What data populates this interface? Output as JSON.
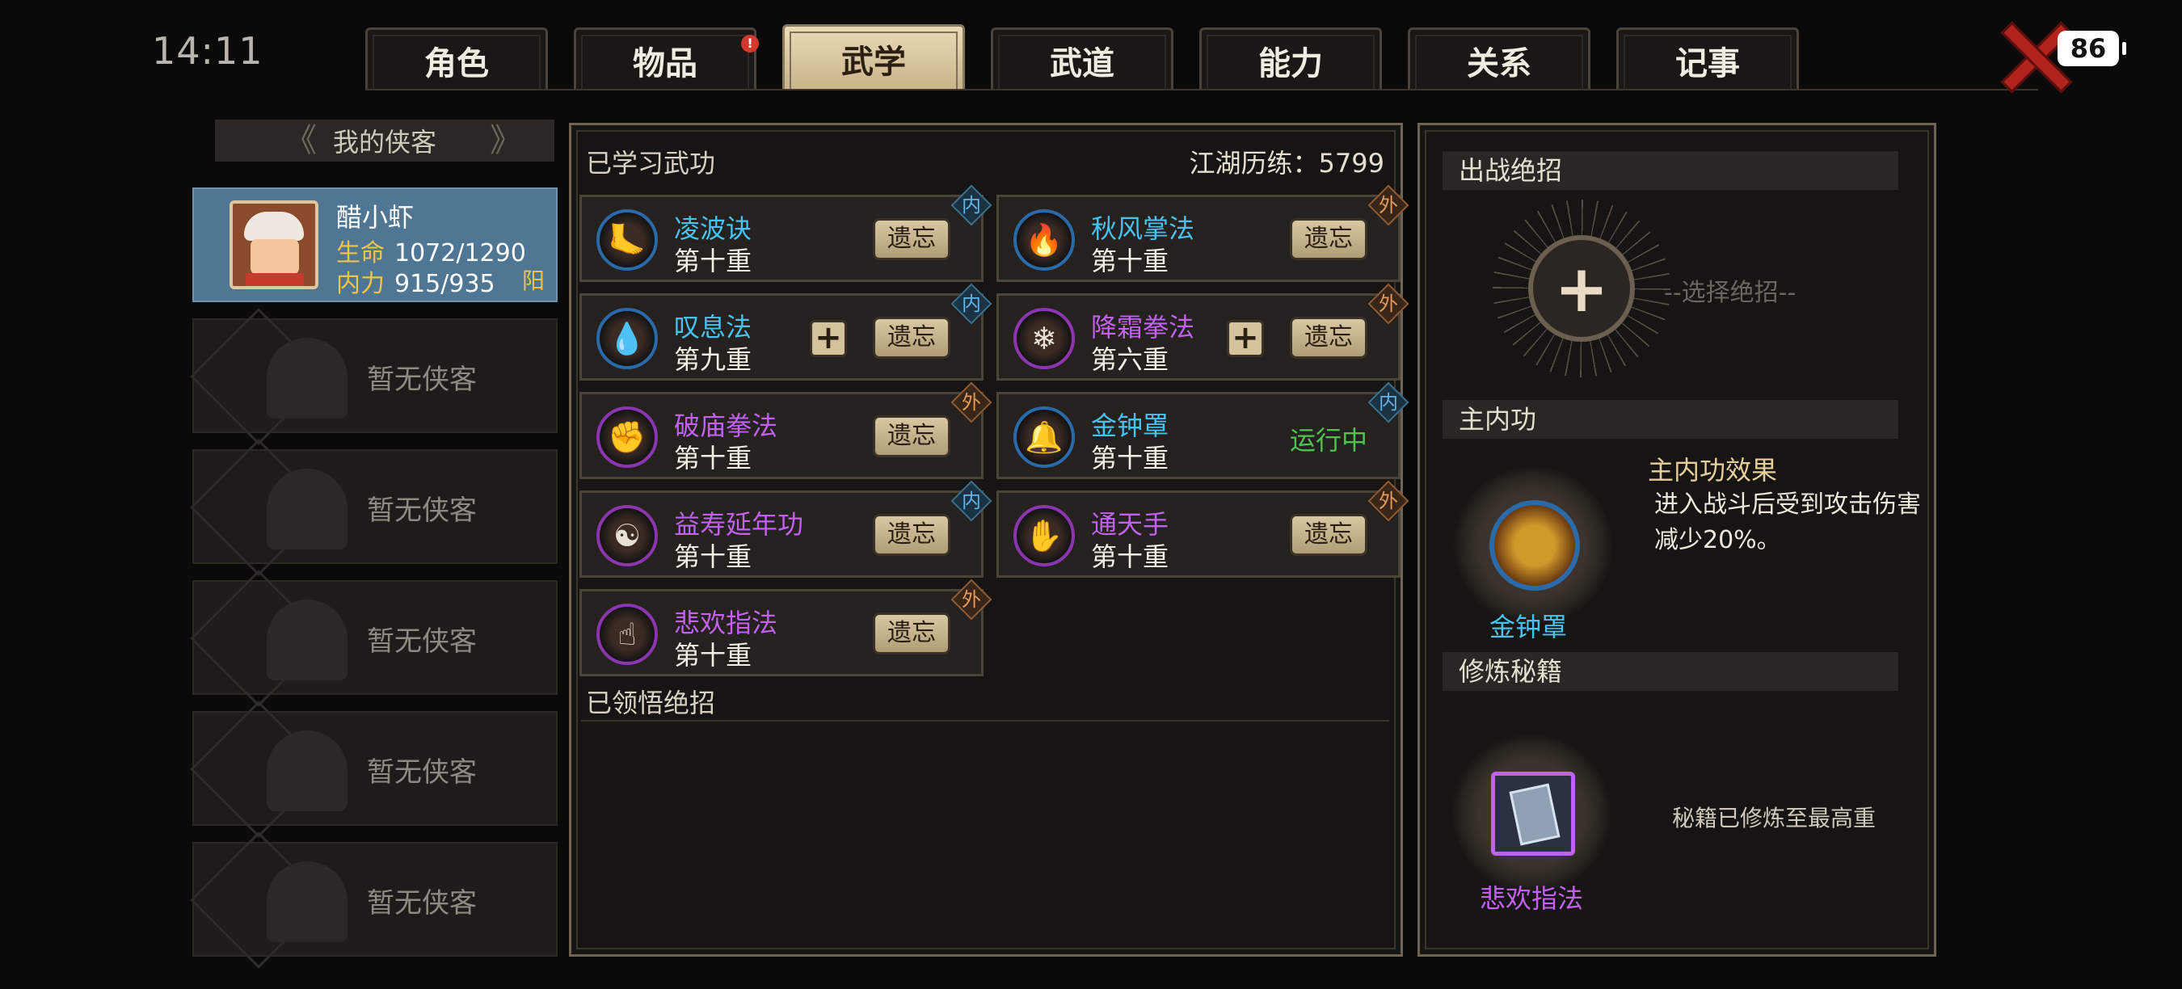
{
  "status_bar": {
    "time": "14:11",
    "battery": "86"
  },
  "tabs": [
    {
      "label": "角色",
      "active": false
    },
    {
      "label": "物品",
      "active": false,
      "notification": "!"
    },
    {
      "label": "武学",
      "active": true
    },
    {
      "label": "武道",
      "active": false
    },
    {
      "label": "能力",
      "active": false
    },
    {
      "label": "关系",
      "active": false
    },
    {
      "label": "记事",
      "active": false
    }
  ],
  "left_panel": {
    "title": "我的侠客",
    "selected": {
      "name": "醋小虾",
      "hp_label": "生命",
      "hp_value": "1072/1290",
      "mp_label": "内力",
      "mp_value": "915/935",
      "attribute": "阳"
    },
    "empty_text": "暂无侠客"
  },
  "middle_panel": {
    "learned_title": "已学习武功",
    "experience_label": "江湖历练：5799",
    "forget_label": "遗忘",
    "running_label": "运行中",
    "skills": [
      {
        "name": "凌波诀",
        "level": "第十重",
        "type": "内",
        "color": "#48c3f0"
      },
      {
        "name": "秋风掌法",
        "level": "第十重",
        "type": "外",
        "color": "#48c3f0"
      },
      {
        "name": "叹息法",
        "level": "第九重",
        "type": "内",
        "color": "#48c3f0"
      },
      {
        "name": "降霜拳法",
        "level": "第六重",
        "type": "外",
        "color": "#c260f0"
      },
      {
        "name": "破庙拳法",
        "level": "第十重",
        "type": "外",
        "color": "#c260f0"
      },
      {
        "name": "金钟罩",
        "level": "第十重",
        "type": "内",
        "color": "#48c3f0"
      },
      {
        "name": "益寿延年功",
        "level": "第十重",
        "type": "内",
        "color": "#c260f0"
      },
      {
        "name": "通天手",
        "level": "第十重",
        "type": "外",
        "color": "#c260f0"
      },
      {
        "name": "悲欢指法",
        "level": "第十重",
        "type": "外",
        "color": "#c260f0"
      }
    ],
    "ultimate_title": "已领悟绝招"
  },
  "right_panel": {
    "battle_title": "出战绝招",
    "choose_text": "--选择绝招--",
    "inner_title": "主内功",
    "inner_effect_title": "主内功效果",
    "inner_effect_text": "进入战斗后受到攻击伤害减少20%。",
    "inner_name": "金钟罩",
    "manual_title": "修炼秘籍",
    "manual_name": "悲欢指法",
    "manual_status": "秘籍已修炼至最高重"
  }
}
